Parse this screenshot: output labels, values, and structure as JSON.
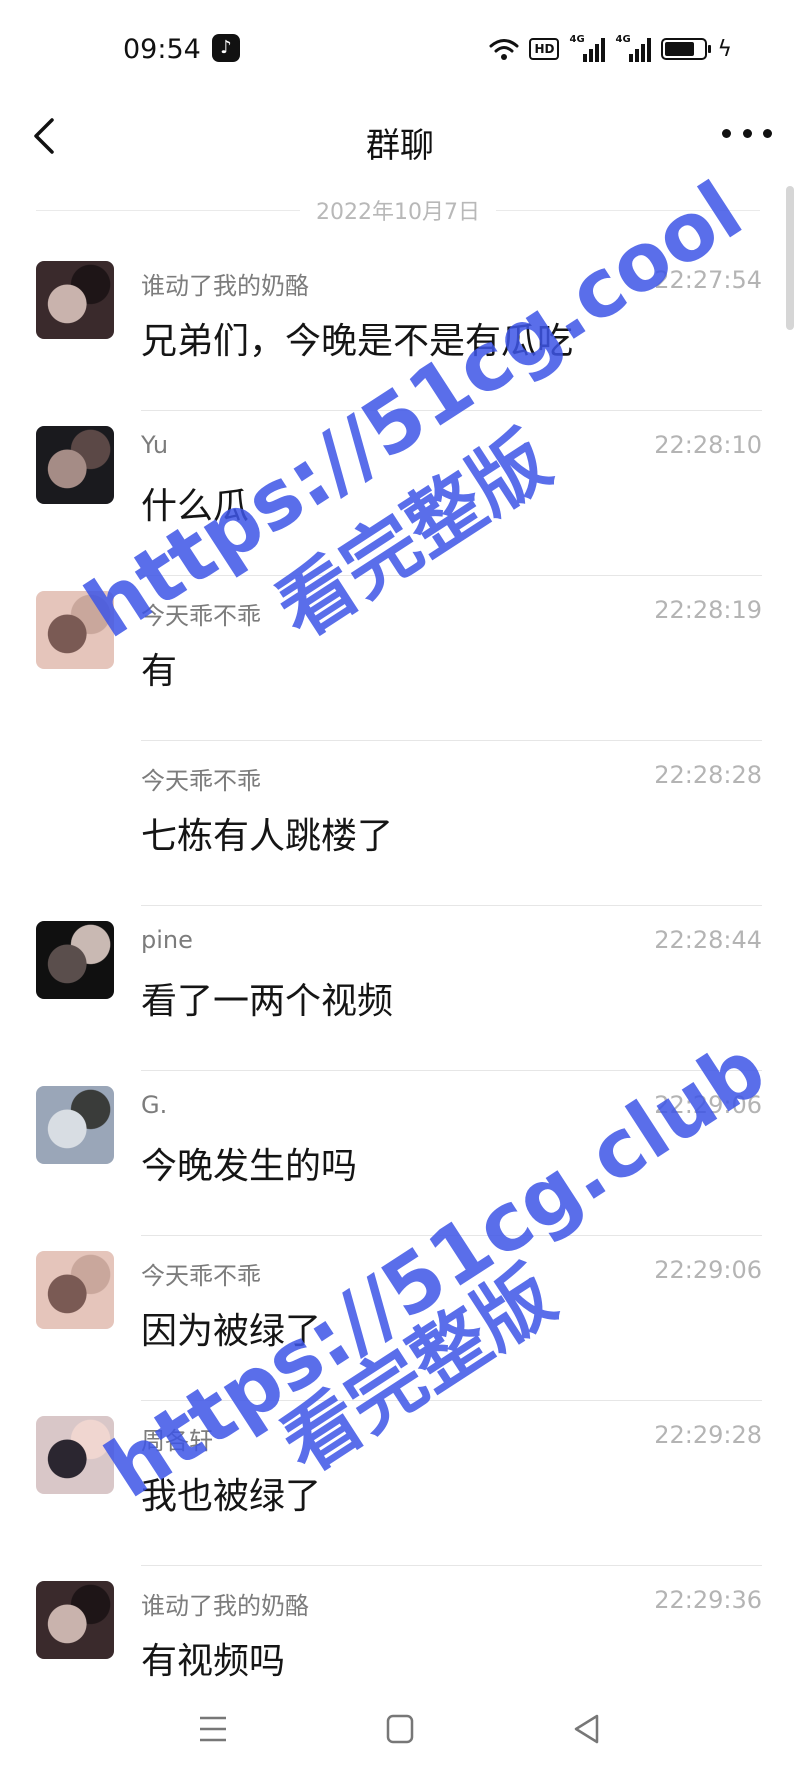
{
  "status_bar": {
    "time": "09:54",
    "app_badge_icon": "tiktok-icon",
    "hd_label": "HD",
    "network_1": "4G",
    "network_2": "4G",
    "battery_level": 0.75
  },
  "header": {
    "title": "群聊",
    "back_icon": "back-chevron-icon",
    "more_icon": "more-dots-icon"
  },
  "date_divider": "2022年10月7日",
  "messages": [
    {
      "sender": "谁动了我的奶酪",
      "time": "22:27:54",
      "text": "兄弟们，今晚是不是有瓜吃",
      "avatar_colors": [
        "#3a2a2c",
        "#c9b3ad",
        "#1e1517"
      ]
    },
    {
      "sender": "Yu",
      "time": "22:28:10",
      "text": "什么瓜",
      "avatar_colors": [
        "#1a1a1e",
        "#a58c86",
        "#5b4846"
      ]
    },
    {
      "sender": "今天乖不乖",
      "time": "22:28:19",
      "text": "有",
      "avatar_colors": [
        "#e5c5bb",
        "#7a5a54",
        "#c9a79c"
      ]
    },
    {
      "sender": "今天乖不乖",
      "time": "22:28:28",
      "text": "七栋有人跳楼了",
      "avatar_colors": []
    },
    {
      "sender": "pine",
      "time": "22:28:44",
      "text": "看了一两个视频",
      "avatar_colors": [
        "#101010",
        "#5a4e4c",
        "#c9b9b3"
      ]
    },
    {
      "sender": "G.",
      "time": "22:29:06",
      "text": "今晚发生的吗",
      "avatar_colors": [
        "#9aa6b8",
        "#d8dde3",
        "#3a3c3a"
      ]
    },
    {
      "sender": "今天乖不乖",
      "time": "22:29:06",
      "text": "因为被绿了",
      "avatar_colors": [
        "#e5c5bb",
        "#7a5a54",
        "#c9a79c"
      ]
    },
    {
      "sender": "周各轩",
      "time": "22:29:28",
      "text": "我也被绿了",
      "avatar_colors": [
        "#d9c7c8",
        "#2b2630",
        "#f0d6d0"
      ]
    },
    {
      "sender": "谁动了我的奶酪",
      "time": "22:29:36",
      "text": "有视频吗",
      "avatar_colors": [
        "#3a2a2c",
        "#c9b3ad",
        "#1e1517"
      ]
    }
  ],
  "watermarks": [
    {
      "url": "https://51cg.cool",
      "caption": "看完整版"
    },
    {
      "url": "https://51cg.club",
      "caption": "看完整版"
    }
  ],
  "colors": {
    "watermark": "#3d55e6",
    "separator": "#e6e6e6",
    "time_text": "#b4b4b4",
    "sender_text": "#7c7c7c"
  },
  "nav_bar": {
    "menu_icon": "menu-lines-icon",
    "home_icon": "home-square-icon",
    "back_icon": "back-triangle-icon"
  }
}
